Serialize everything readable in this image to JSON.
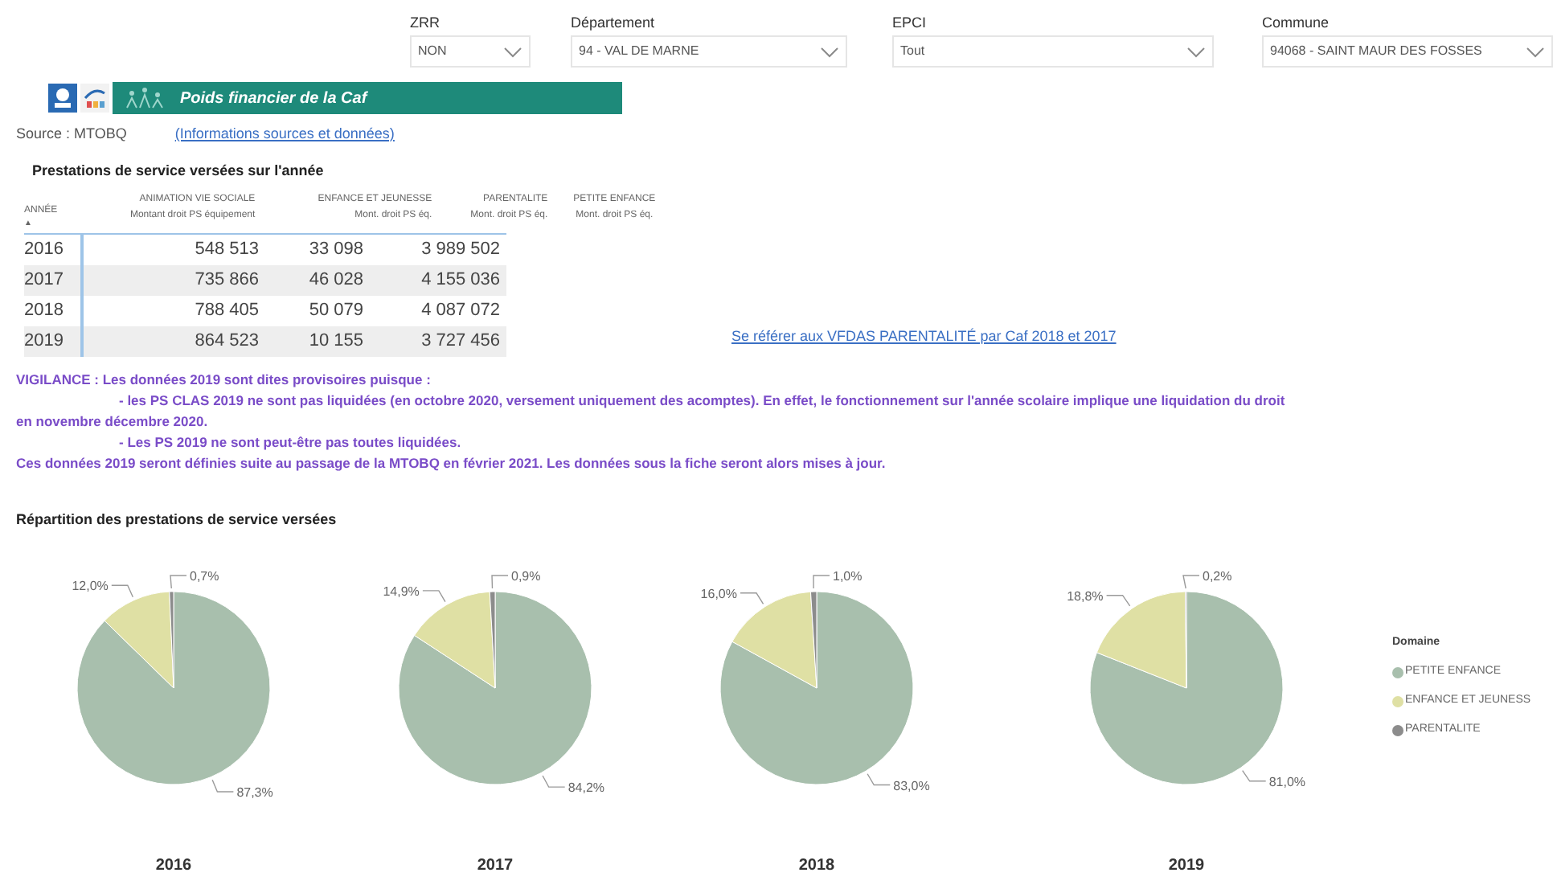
{
  "filters": [
    {
      "label": "ZRR",
      "value": "NON"
    },
    {
      "label": "Département",
      "value": "94 - VAL DE MARNE"
    },
    {
      "label": "EPCI",
      "value": "Tout"
    },
    {
      "label": "Commune",
      "value": "94068 - SAINT MAUR DES FOSSES"
    }
  ],
  "banner": {
    "title": "Poids financier de la Caf"
  },
  "source": {
    "text": "Source : MTOBQ",
    "link": "(Informations sources et données)"
  },
  "table": {
    "title": "Prestations de service versées sur l'année",
    "year_header": "ANNÉE",
    "sort_mark": "▲",
    "columns": [
      {
        "group": "ANIMATION VIE SOCIALE",
        "measure": "Montant droit PS équipement"
      },
      {
        "group": "ENFANCE ET JEUNESSE",
        "measure": "Mont. droit PS éq."
      },
      {
        "group": "PARENTALITE",
        "measure": "Mont. droit PS éq."
      },
      {
        "group": "PETITE ENFANCE",
        "measure": "Mont. droit PS éq."
      }
    ],
    "rows": [
      {
        "year": "2016",
        "values": [
          "548 513",
          "33 098",
          "3 989 502"
        ]
      },
      {
        "year": "2017",
        "values": [
          "735 866",
          "46 028",
          "4 155 036"
        ]
      },
      {
        "year": "2018",
        "values": [
          "788 405",
          "50 079",
          "4 087 072"
        ]
      },
      {
        "year": "2019",
        "values": [
          "864 523",
          "10 155",
          "3 727 456"
        ]
      }
    ]
  },
  "vfdas_link": "Se référer aux VFDAS PARENTALITÉ par Caf 2018 et 2017",
  "warning": [
    {
      "text": "**VIGILANCE :**  Les données 2019 sont dites provisoires puisque :",
      "indent": false
    },
    {
      "text": "- les PS CLAS 2019 ne sont pas liquidées (en octobre 2020, versement uniquement des acomptes). En effet, le fonctionnement sur l'année scolaire implique une liquidation du droit en novembre décembre 2020.",
      "indent": true
    },
    {
      "text": "- Les PS 2019 ne sont peut-être pas toutes liquidées.",
      "indent": true
    },
    {
      "text": "Ces données 2019 seront définies suite au passage de la MTOBQ en février 2021. Les données sous la fiche seront alors mises à jour.",
      "indent": false
    }
  ],
  "distribution": {
    "title": "Répartition des prestations de service versées",
    "charts": [
      {
        "chart_data": {
          "type": "pie",
          "title": "2016",
          "values": [
            87.3,
            12.0,
            0.7
          ],
          "value_labels": [
            "87,3%",
            "12,0%",
            "0,7%"
          ]
        }
      },
      {
        "chart_data": {
          "type": "pie",
          "title": "2017",
          "values": [
            84.2,
            14.9,
            0.9
          ],
          "value_labels": [
            "84,2%",
            "14,9%",
            "0,9%"
          ]
        }
      },
      {
        "chart_data": {
          "type": "pie",
          "title": "2018",
          "values": [
            83.0,
            16.0,
            1.0
          ],
          "value_labels": [
            "83,0%",
            "16,0%",
            "1,0%"
          ]
        }
      },
      {
        "chart_data": {
          "type": "pie",
          "title": "2019",
          "values": [
            81.0,
            18.8,
            0.2
          ],
          "value_labels": [
            "81,0%",
            "18,8%",
            "0,2%"
          ]
        }
      }
    ],
    "legend": {
      "title": "Domaine",
      "items": [
        {
          "label": "PETITE ENFANCE",
          "color": "#a8bfad"
        },
        {
          "label": "ENFANCE ET JEUNESS",
          "color": "#dfe0a4"
        },
        {
          "label": "PARENTALITE",
          "color": "#8c8c8c"
        }
      ]
    }
  }
}
